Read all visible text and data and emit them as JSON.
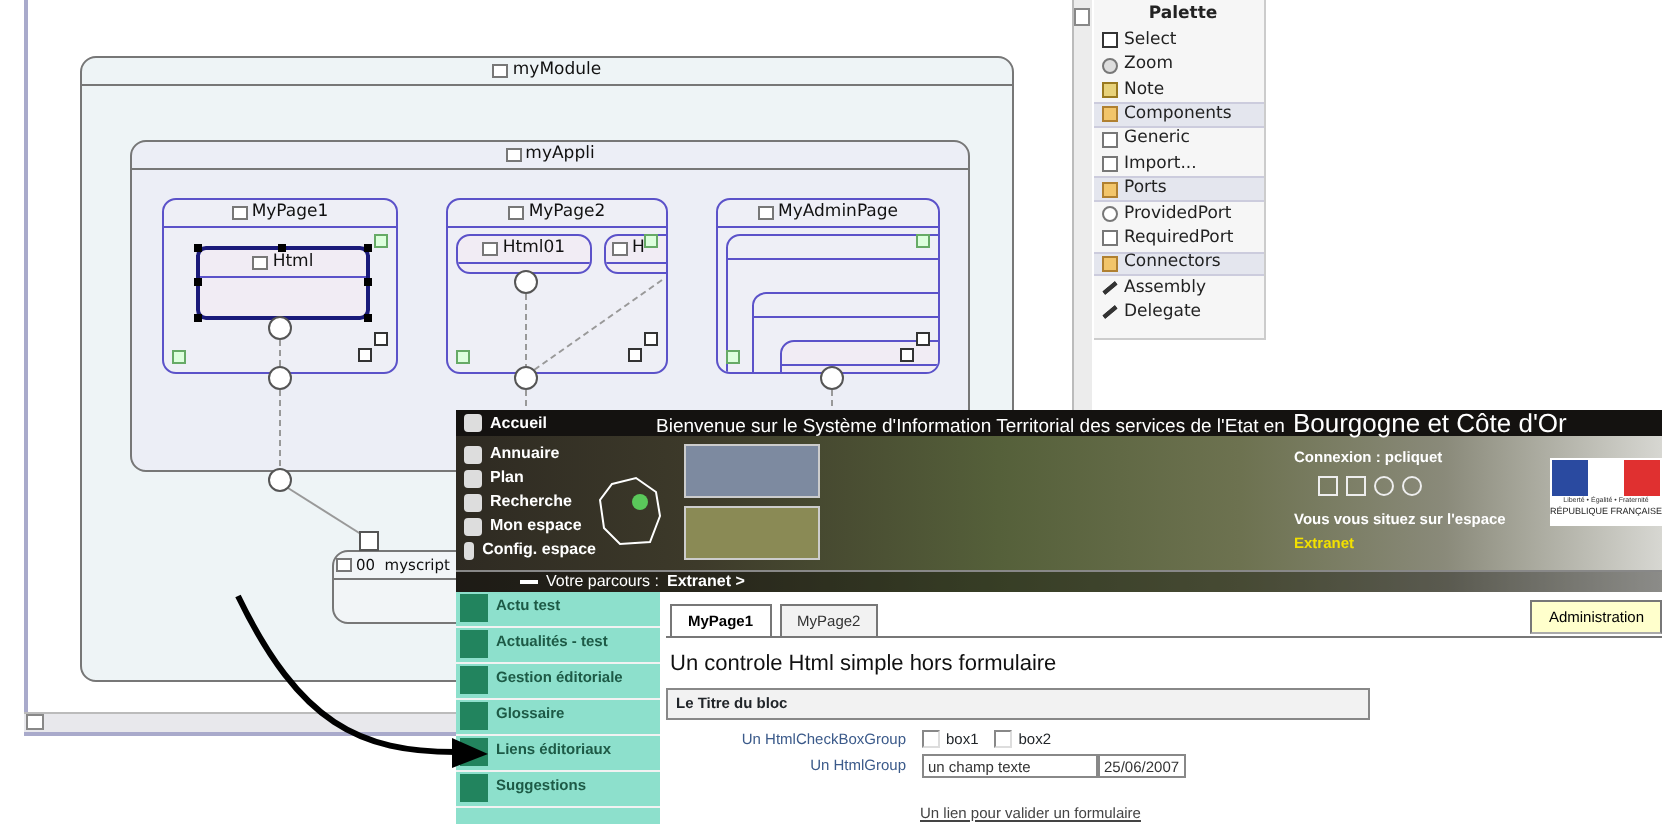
{
  "diagram": {
    "module": {
      "title": "myModule"
    },
    "application": {
      "title": "myAppli"
    },
    "pages": [
      {
        "title": "MyPage1",
        "components": [
          {
            "title": "Html",
            "selected": true
          }
        ]
      },
      {
        "title": "MyPage2",
        "components": [
          {
            "title": "Html01",
            "selected": false
          },
          {
            "title": "H",
            "selected": false
          }
        ]
      },
      {
        "title": "MyAdminPage"
      }
    ],
    "script": {
      "title": "00  myscript"
    }
  },
  "palette": {
    "title": "Palette",
    "items": [
      {
        "label": "Select",
        "kind": "select"
      },
      {
        "label": "Zoom",
        "kind": "zoom"
      },
      {
        "label": "Note",
        "kind": "note"
      },
      {
        "label": "Components",
        "kind": "drawer"
      },
      {
        "label": "Generic",
        "kind": "component"
      },
      {
        "label": "Import...",
        "kind": "component"
      },
      {
        "label": "Ports",
        "kind": "drawer"
      },
      {
        "label": "ProvidedPort",
        "kind": "provided-port"
      },
      {
        "label": "RequiredPort",
        "kind": "required-port"
      },
      {
        "label": "Connectors",
        "kind": "drawer"
      },
      {
        "label": "Assembly",
        "kind": "connector"
      },
      {
        "label": "Delegate",
        "kind": "connector"
      }
    ]
  },
  "website": {
    "nav": [
      {
        "label": "Accueil"
      },
      {
        "label": "Annuaire"
      },
      {
        "label": "Plan"
      },
      {
        "label": "Recherche"
      },
      {
        "label": "Mon espace"
      },
      {
        "label": "Config. espace"
      }
    ],
    "welcome": "Bienvenue sur le Système d'Information Territorial des services de l'Etat en",
    "region": "Bourgogne et Côte d'Or",
    "connection": "Connexion : pcliquet",
    "space_label": "Vous vous situez sur l'espace",
    "space": "Extranet",
    "logo_motto": "Liberté • Égalité • Fraternité",
    "logo_name": "RÉPUBLIQUE FRANÇAISE",
    "breadcrumb_label": "Votre parcours :",
    "breadcrumb": "Extranet >",
    "menu": [
      {
        "label": "Actu test"
      },
      {
        "label": "Actualités - test"
      },
      {
        "label": "Gestion éditoriale"
      },
      {
        "label": "Glossaire"
      },
      {
        "label": "Liens éditoriaux"
      },
      {
        "label": "Suggestions"
      }
    ],
    "tabs": [
      {
        "label": "MyPage1",
        "selected": true
      },
      {
        "label": "MyPage2",
        "selected": false
      }
    ],
    "admin_button": "Administration",
    "heading": "Un controle Html simple hors formulaire",
    "block_title": "Le Titre du bloc",
    "checkbox_group": {
      "label": "Un HtmlCheckBoxGroup",
      "boxes": [
        {
          "label": "box1",
          "checked": false
        },
        {
          "label": "box2",
          "checked": false
        }
      ]
    },
    "field_group": {
      "label": "Un HtmlGroup",
      "fields": [
        {
          "value": "un champ texte"
        },
        {
          "value": "25/06/2007"
        }
      ]
    },
    "submit_link": "Un lien pour valider un formulaire"
  }
}
